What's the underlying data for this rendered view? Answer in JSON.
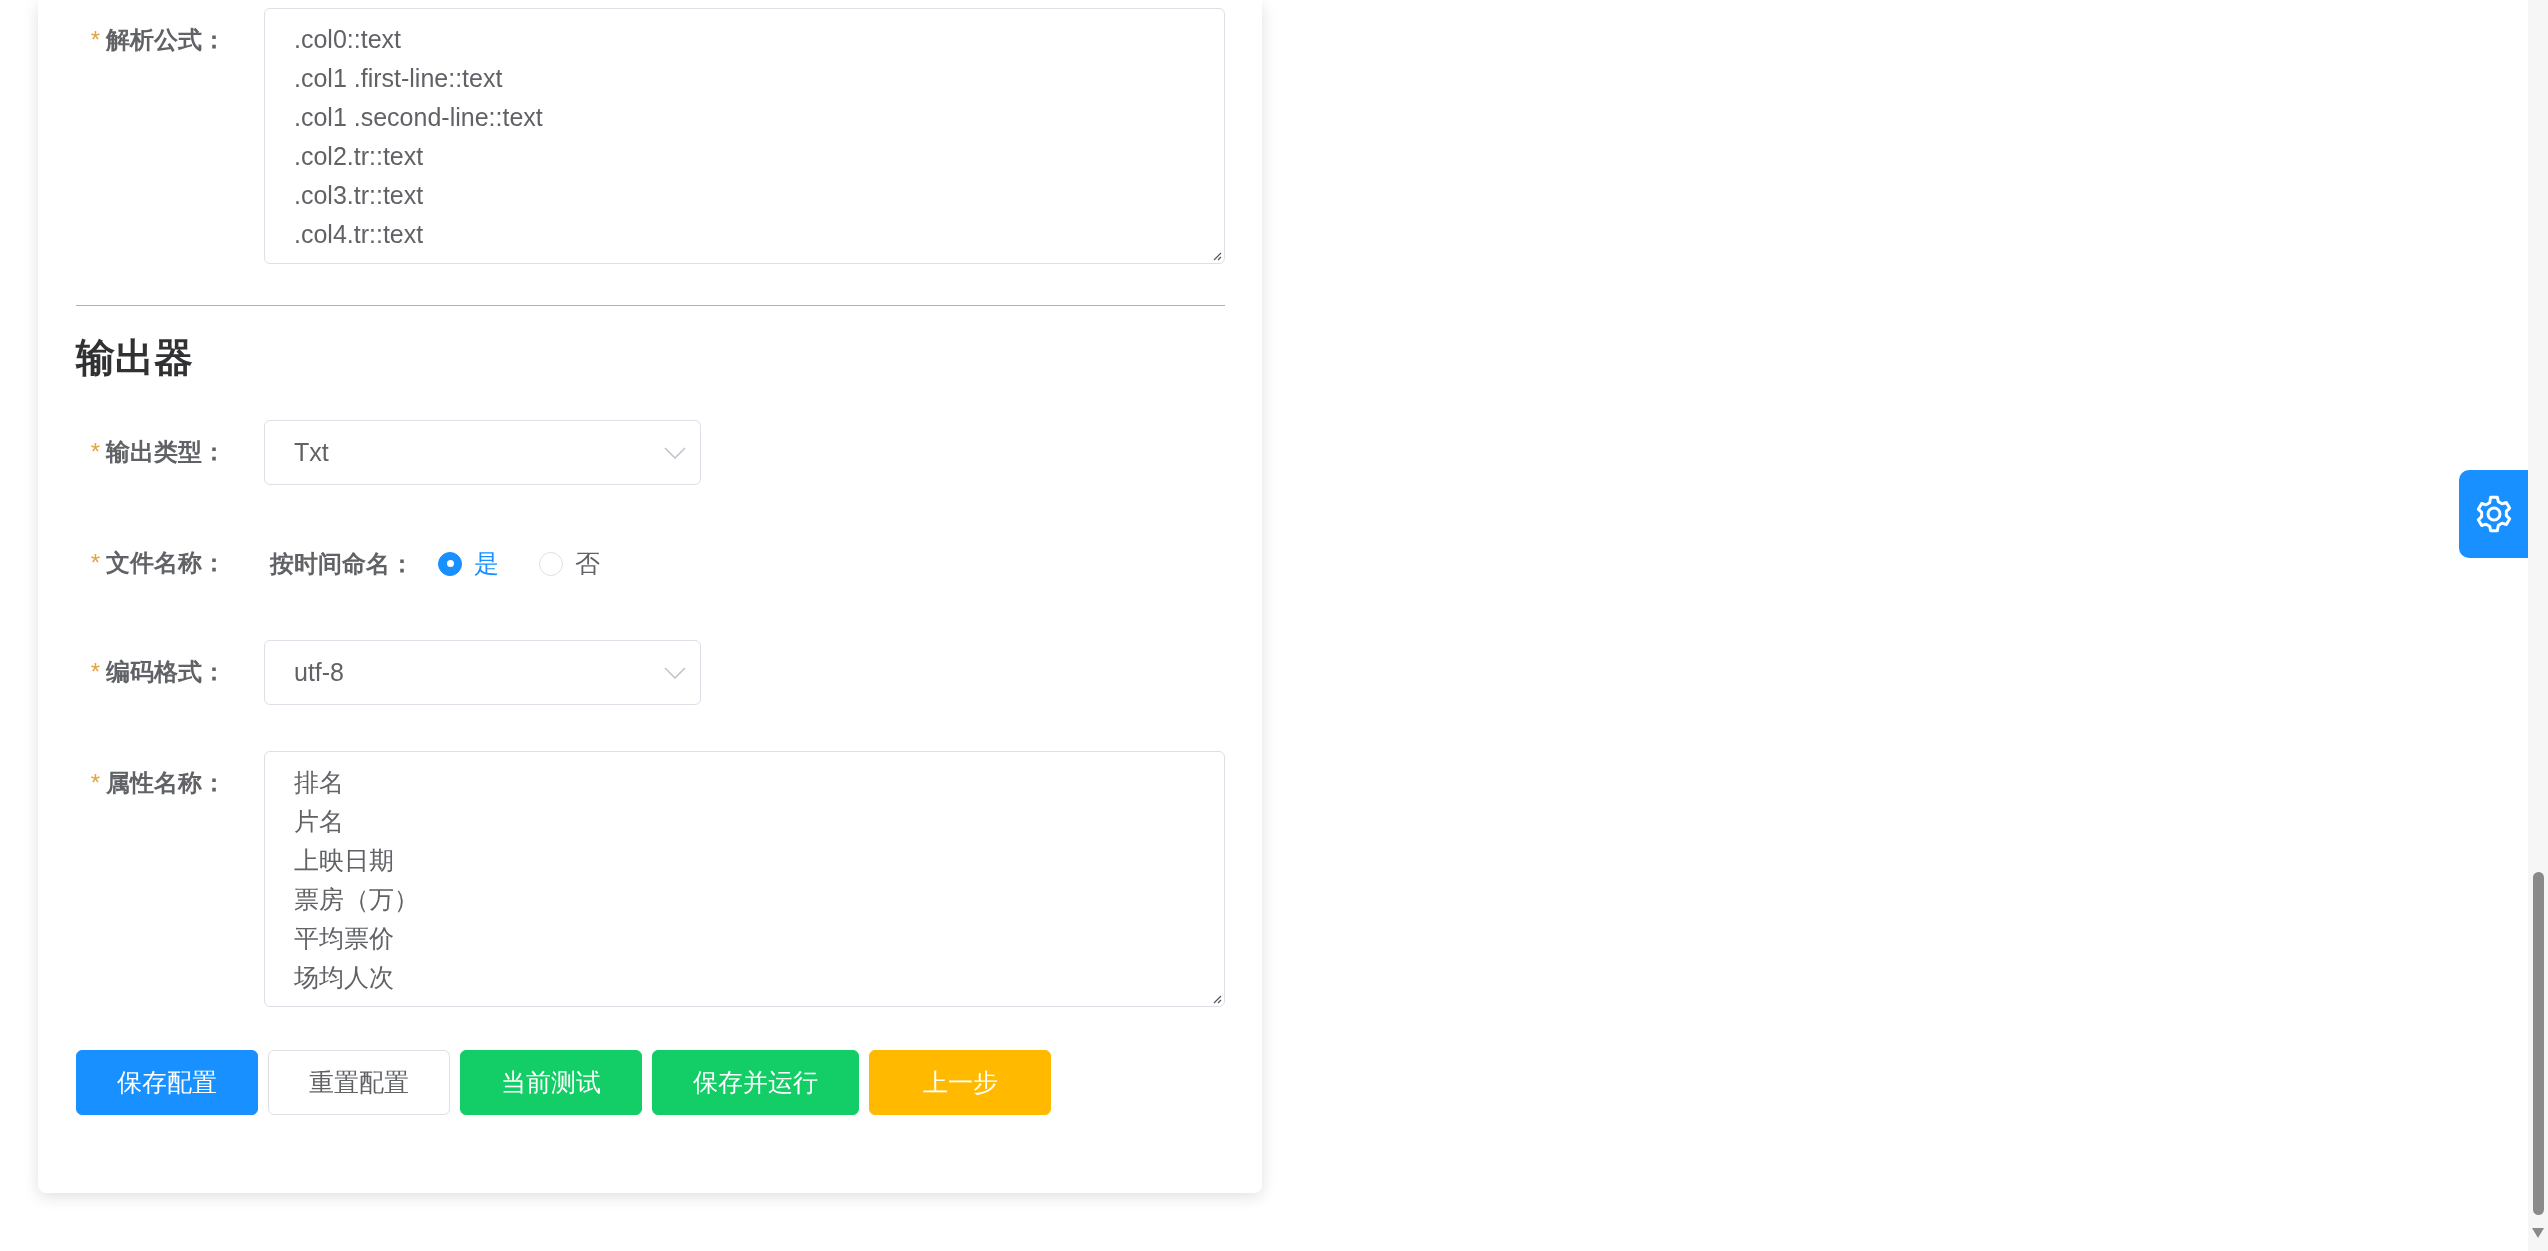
{
  "parser_field": {
    "label": "解析公式：",
    "required_mark": "*",
    "lines": [
      ".col0::text",
      ".col1 .first-line::text",
      ".col1 .second-line::text",
      ".col2.tr::text",
      ".col3.tr::text",
      ".col4.tr::text"
    ]
  },
  "output": {
    "heading": "输出器",
    "fields": [
      {
        "kind": "select",
        "label": "输出类型：",
        "required_mark": "*",
        "value": "Txt"
      },
      {
        "kind": "radio",
        "label": "文件名称：",
        "required_mark": "*",
        "sublabel": "按时间命名：",
        "options": [
          {
            "label": "是",
            "selected": true
          },
          {
            "label": "否",
            "selected": false
          }
        ]
      },
      {
        "kind": "select",
        "label": "编码格式：",
        "required_mark": "*",
        "value": "utf-8"
      },
      {
        "kind": "textarea",
        "label": "属性名称：",
        "required_mark": "*",
        "lines": [
          "排名",
          "片名",
          "上映日期",
          "票房（万）",
          "平均票价",
          "场均人次"
        ]
      }
    ]
  },
  "buttons": [
    {
      "label": "保存配置",
      "kind": "primary"
    },
    {
      "label": "重置配置",
      "kind": "default"
    },
    {
      "label": "当前测试",
      "kind": "success"
    },
    {
      "label": "保存并运行",
      "kind": "success"
    },
    {
      "label": "上一步",
      "kind": "warning"
    }
  ]
}
